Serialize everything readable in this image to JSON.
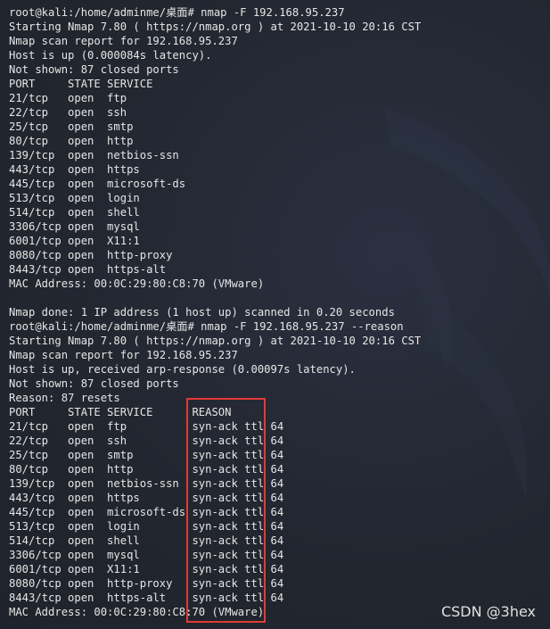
{
  "terminal": {
    "lines": [
      "root@kali:/home/adminme/桌面# nmap -F 192.168.95.237",
      "Starting Nmap 7.80 ( https://nmap.org ) at 2021-10-10 20:16 CST",
      "Nmap scan report for 192.168.95.237",
      "Host is up (0.000084s latency).",
      "Not shown: 87 closed ports",
      "PORT     STATE SERVICE",
      "21/tcp   open  ftp",
      "22/tcp   open  ssh",
      "25/tcp   open  smtp",
      "80/tcp   open  http",
      "139/tcp  open  netbios-ssn",
      "443/tcp  open  https",
      "445/tcp  open  microsoft-ds",
      "513/tcp  open  login",
      "514/tcp  open  shell",
      "3306/tcp open  mysql",
      "6001/tcp open  X11:1",
      "8080/tcp open  http-proxy",
      "8443/tcp open  https-alt",
      "MAC Address: 00:0C:29:80:C8:70 (VMware)",
      "",
      "Nmap done: 1 IP address (1 host up) scanned in 0.20 seconds",
      "root@kali:/home/adminme/桌面# nmap -F 192.168.95.237 --reason",
      "Starting Nmap 7.80 ( https://nmap.org ) at 2021-10-10 20:16 CST",
      "Nmap scan report for 192.168.95.237",
      "Host is up, received arp-response (0.00097s latency).",
      "Not shown: 87 closed ports",
      "Reason: 87 resets",
      "PORT     STATE SERVICE      REASON",
      "21/tcp   open  ftp          syn-ack ttl 64",
      "22/tcp   open  ssh          syn-ack ttl 64",
      "25/tcp   open  smtp         syn-ack ttl 64",
      "80/tcp   open  http         syn-ack ttl 64",
      "139/tcp  open  netbios-ssn  syn-ack ttl 64",
      "443/tcp  open  https        syn-ack ttl 64",
      "445/tcp  open  microsoft-ds syn-ack ttl 64",
      "513/tcp  open  login        syn-ack ttl 64",
      "514/tcp  open  shell        syn-ack ttl 64",
      "3306/tcp open  mysql        syn-ack ttl 64",
      "6001/tcp open  X11:1        syn-ack ttl 64",
      "8080/tcp open  http-proxy   syn-ack ttl 64",
      "8443/tcp open  https-alt    syn-ack ttl 64",
      "MAC Address: 00:0C:29:80:C8:70 (VMware)"
    ]
  },
  "watermark": {
    "text": "CSDN @3hex"
  },
  "colors": {
    "background": "#22262f",
    "text": "#e6e6e6",
    "highlight_box": "#e53935"
  }
}
